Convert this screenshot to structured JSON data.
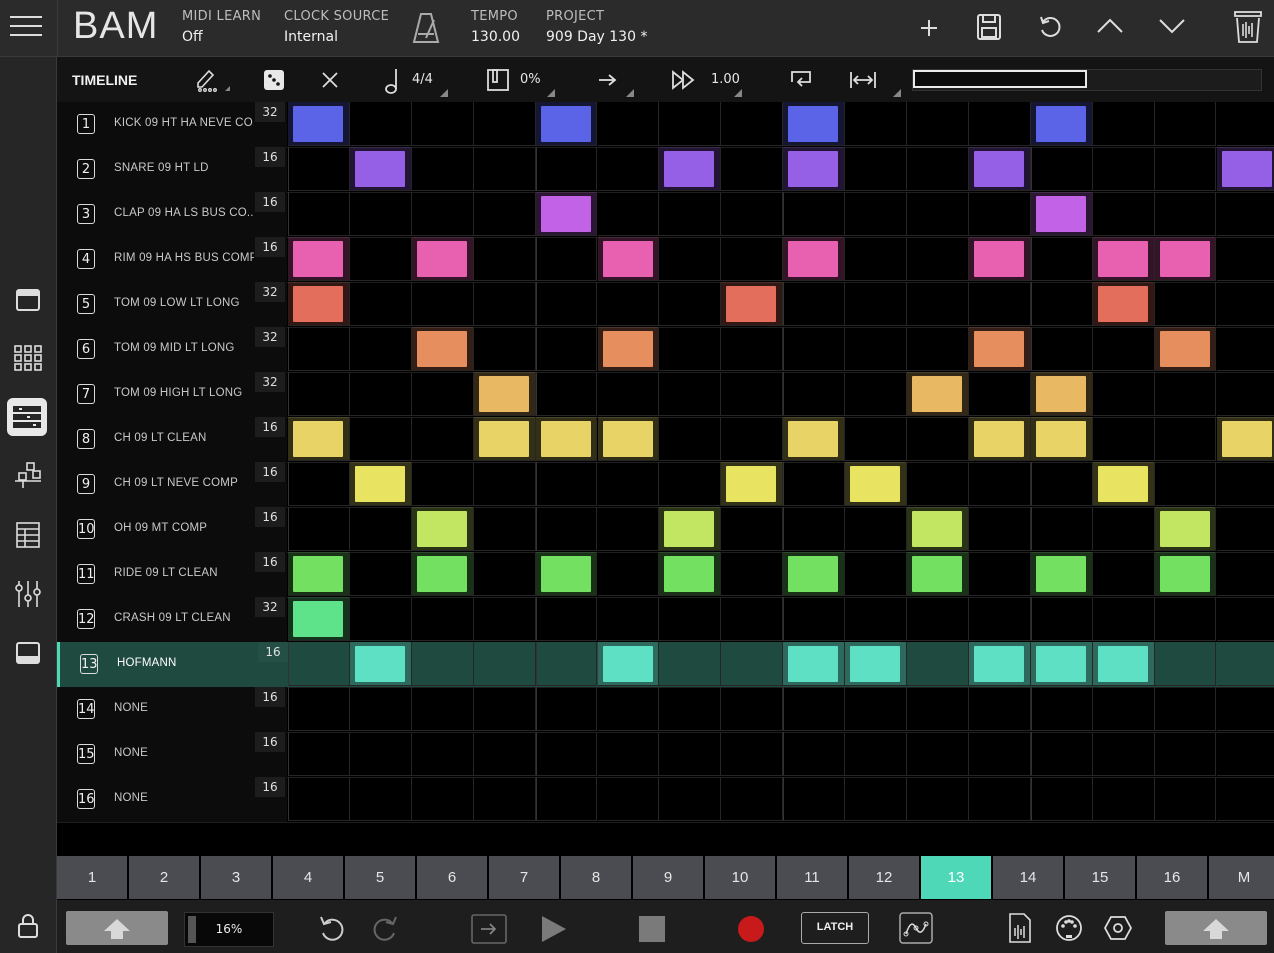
{
  "header": {
    "logo": "BAM",
    "midi_learn_label": "MIDI LEARN",
    "midi_learn_value": "Off",
    "clock_source_label": "CLOCK SOURCE",
    "clock_source_value": "Internal",
    "tempo_label": "TEMPO",
    "tempo_value": "130.00",
    "project_label": "PROJECT",
    "project_value": "909 Day 130 *"
  },
  "toolbar": {
    "title": "TIMELINE",
    "time_signature": "4/4",
    "swing": "0%",
    "speed": "1.00",
    "progress": 0.5
  },
  "tracks": [
    {
      "num": "1",
      "name": "KICK 09 HT HA NEVE CO...",
      "len": "32",
      "color": "#5b63e6",
      "steps": [
        0,
        4,
        8,
        12
      ]
    },
    {
      "num": "2",
      "name": "SNARE 09 HT LD",
      "len": "16",
      "color": "#9660e6",
      "steps": [
        1,
        6,
        8,
        11,
        15
      ]
    },
    {
      "num": "3",
      "name": "CLAP 09 HA LS BUS CO...",
      "len": "16",
      "color": "#c262e6",
      "steps": [
        4,
        12
      ]
    },
    {
      "num": "4",
      "name": "RIM 09 HA HS BUS COMP",
      "len": "16",
      "color": "#e860b0",
      "steps": [
        0,
        2,
        5,
        8,
        11,
        13,
        14
      ]
    },
    {
      "num": "5",
      "name": "TOM 09 LOW LT LONG",
      "len": "32",
      "color": "#e46e5c",
      "steps": [
        0,
        7,
        13
      ]
    },
    {
      "num": "6",
      "name": "TOM 09 MID LT LONG",
      "len": "32",
      "color": "#e78e5e",
      "steps": [
        2,
        5,
        11,
        14
      ]
    },
    {
      "num": "7",
      "name": "TOM 09 HIGH LT LONG",
      "len": "32",
      "color": "#e8b862",
      "steps": [
        3,
        10,
        12
      ]
    },
    {
      "num": "8",
      "name": "CH 09 LT CLEAN",
      "len": "16",
      "color": "#e8d466",
      "steps": [
        0,
        3,
        4,
        5,
        8,
        11,
        12,
        15
      ]
    },
    {
      "num": "9",
      "name": "CH 09 LT NEVE COMP",
      "len": "16",
      "color": "#e8e462",
      "steps": [
        1,
        7,
        9,
        13
      ]
    },
    {
      "num": "10",
      "name": "OH 09 MT COMP",
      "len": "16",
      "color": "#c2e662",
      "steps": [
        2,
        6,
        10,
        14
      ]
    },
    {
      "num": "11",
      "name": "RIDE 09 LT CLEAN",
      "len": "16",
      "color": "#74e062",
      "steps": [
        0,
        2,
        4,
        6,
        8,
        10,
        12,
        14
      ]
    },
    {
      "num": "12",
      "name": "CRASH 09 LT CLEAN",
      "len": "32",
      "color": "#5ee28a",
      "steps": [
        0
      ]
    },
    {
      "num": "13",
      "name": "HOFMANN",
      "len": "16",
      "color": "#5ee0c4",
      "steps": [
        1,
        5,
        8,
        9,
        11,
        12,
        13
      ]
    },
    {
      "num": "14",
      "name": "NONE",
      "len": "16",
      "color": "#5ee0c4",
      "steps": []
    },
    {
      "num": "15",
      "name": "NONE",
      "len": "16",
      "color": "#5ee0c4",
      "steps": []
    },
    {
      "num": "16",
      "name": "NONE",
      "len": "16",
      "color": "#5ee0c4",
      "steps": []
    }
  ],
  "selected_track": "13",
  "patterns": [
    "1",
    "2",
    "3",
    "4",
    "5",
    "6",
    "7",
    "8",
    "9",
    "10",
    "11",
    "12",
    "13",
    "14",
    "15",
    "16",
    "M"
  ],
  "selected_pattern": "13",
  "transport": {
    "cpu": "16%",
    "latch": "LATCH"
  },
  "colors": {
    "accent": "#4fd8b8",
    "selected_row": "#1f4a40",
    "record": "#c81a1a"
  }
}
